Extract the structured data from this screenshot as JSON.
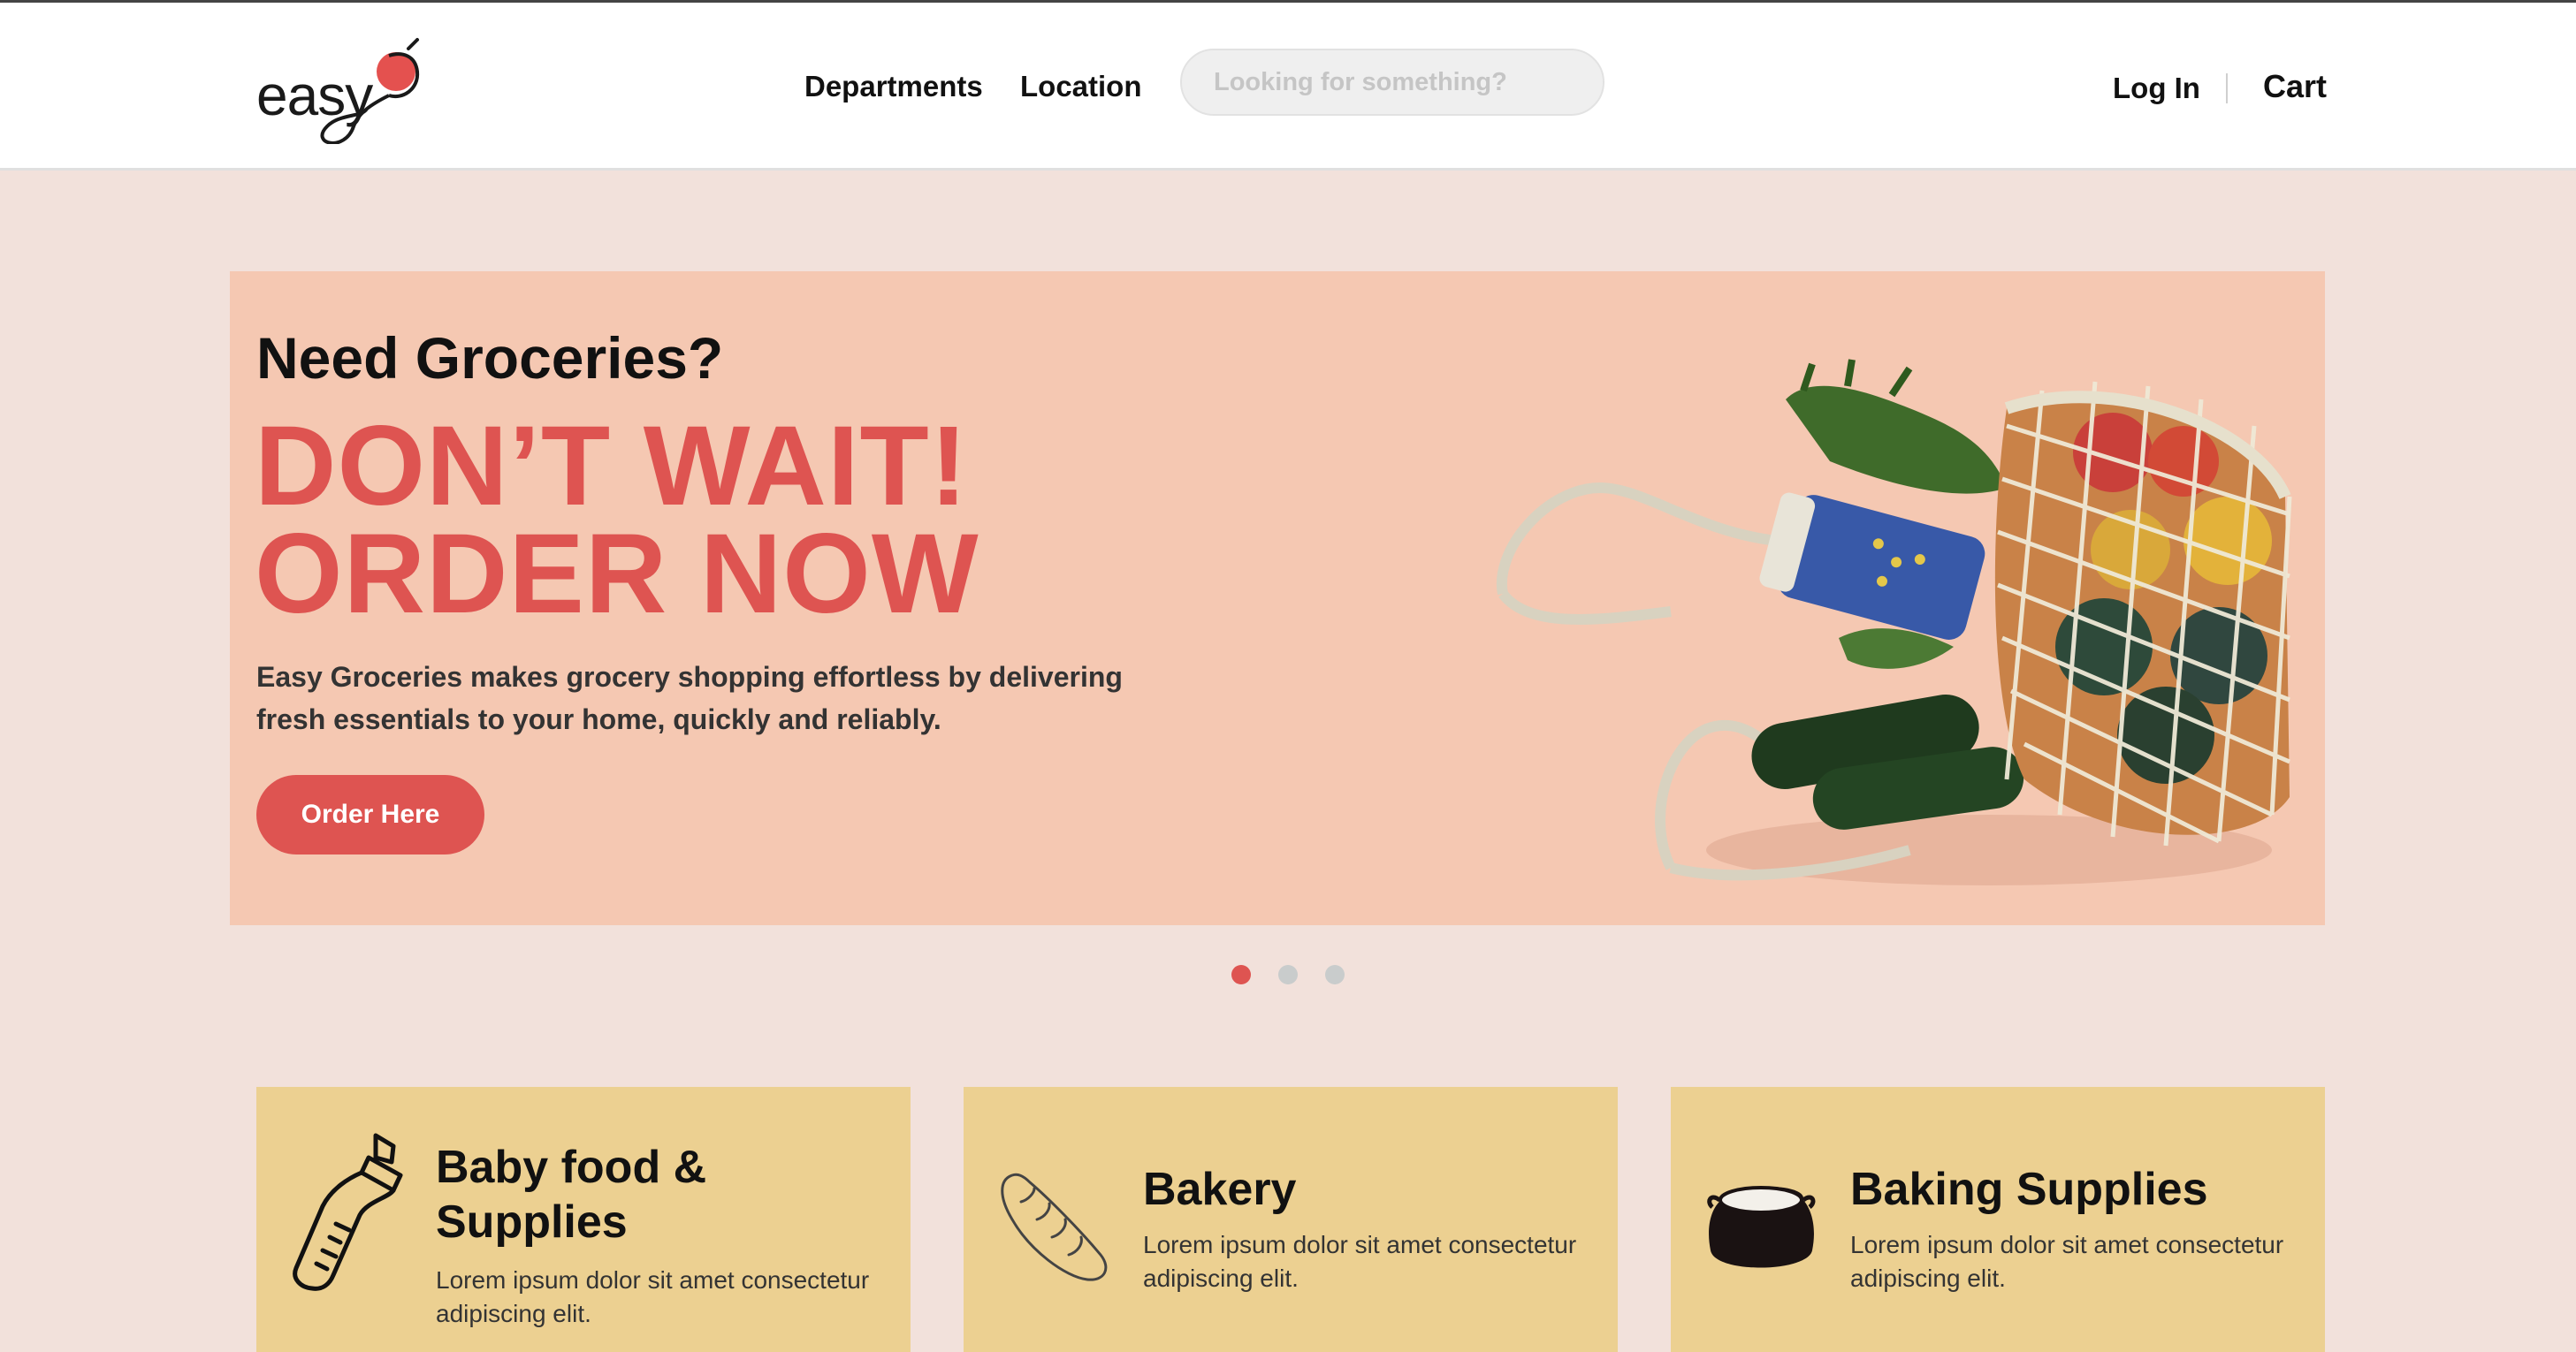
{
  "header": {
    "logo_text": "easy",
    "nav": [
      "Departments",
      "Location"
    ],
    "search": {
      "placeholder": "Looking for something?",
      "value": ""
    },
    "login_label": "Log In",
    "cart_label": "Cart"
  },
  "hero": {
    "kicker": "Need Groceries?",
    "headline_line1": "DON’T WAIT!",
    "headline_line2": "ORDER NOW",
    "description": "Easy Groceries makes grocery shopping effortless by delivering fresh essentials to your home, quickly and reliably.",
    "button_label": "Order Here",
    "image": "grocery-mesh-bag-illustration"
  },
  "carousel": {
    "slide_count": 3,
    "active_index": 0
  },
  "categories": [
    {
      "title": "Baby food & Supplies",
      "description": "Lorem ipsum dolor sit amet consectetur adipiscing elit.",
      "icon": "baby-bottle-icon"
    },
    {
      "title": "Bakery",
      "description": "Lorem ipsum dolor sit amet consectetur adipiscing elit.",
      "icon": "bread-icon"
    },
    {
      "title": "Baking Supplies",
      "description": "Lorem ipsum dolor sit amet consectetur adipiscing elit.",
      "icon": "flour-sack-icon"
    }
  ],
  "colors": {
    "page_bg": "#f2e1db",
    "hero_bg": "#f5c8b2",
    "accent": "#de5451",
    "card_bg": "#ecd091",
    "dot_inactive": "#c9cccc"
  }
}
